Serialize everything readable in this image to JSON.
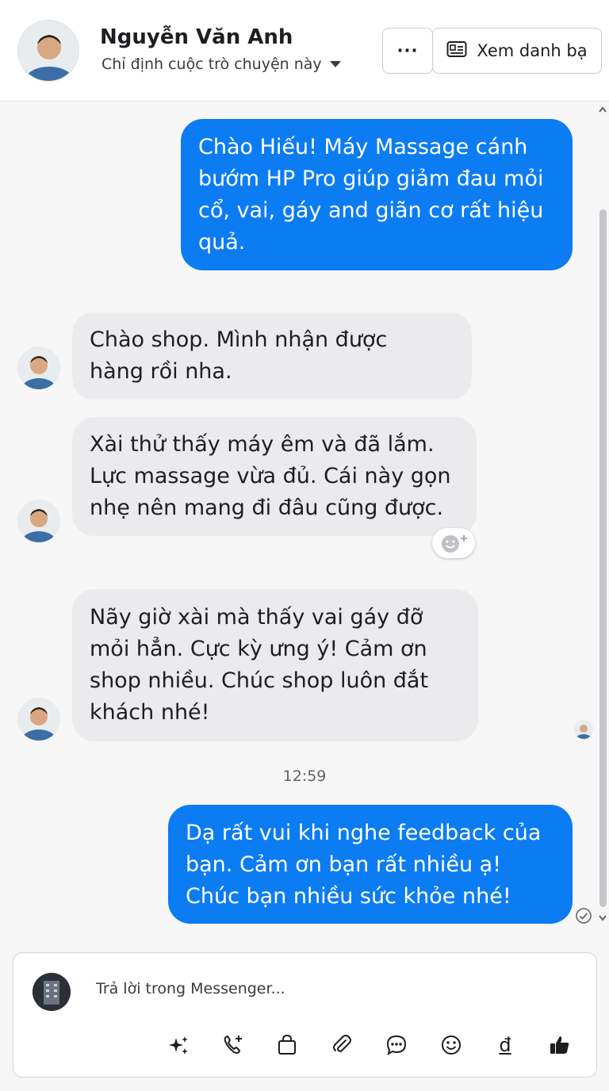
{
  "header": {
    "contact_name": "Nguyễn Văn Anh",
    "assign_label": "Chỉ định cuộc trò chuyện này",
    "more_label": "···",
    "view_contacts_label": "Xem danh bạ"
  },
  "messages": [
    {
      "direction": "outgoing",
      "text": "Chào Hiếu! Máy Massage cánh\nbướm HP Pro giúp giảm đau mỏi\ncổ, vai, gáy and giãn cơ rất hiệu\nquả."
    },
    {
      "direction": "incoming",
      "text": "Chào shop. Mình nhận được\nhàng rồi nha."
    },
    {
      "direction": "incoming",
      "text": "Xài thử thấy máy êm và đã lắm.\nLực massage vừa đủ. Cái này gọn\nnhẹ nên mang đi đâu cũng được."
    },
    {
      "direction": "incoming",
      "text": "Nãy giờ xài mà thấy vai gáy đỡ\nmỏi hẳn. Cực kỳ ưng ý! Cảm ơn\nshop nhiều. Chúc shop luôn đắt\nkhách nhé!"
    },
    {
      "direction": "outgoing",
      "text": "Dạ rất vui khi nghe feedback của\nbạn. Cảm ơn bạn rất nhiều ạ!\nChúc bạn nhiều sức khỏe nhé!"
    }
  ],
  "timestamp": "12:59",
  "composer": {
    "placeholder": "Trả lời trong Messenger...",
    "currency_symbol": "đ"
  },
  "colors": {
    "outgoing_bubble": "#0c7cf3",
    "incoming_bubble": "#ebebed",
    "accent": "#0c7cf3"
  }
}
